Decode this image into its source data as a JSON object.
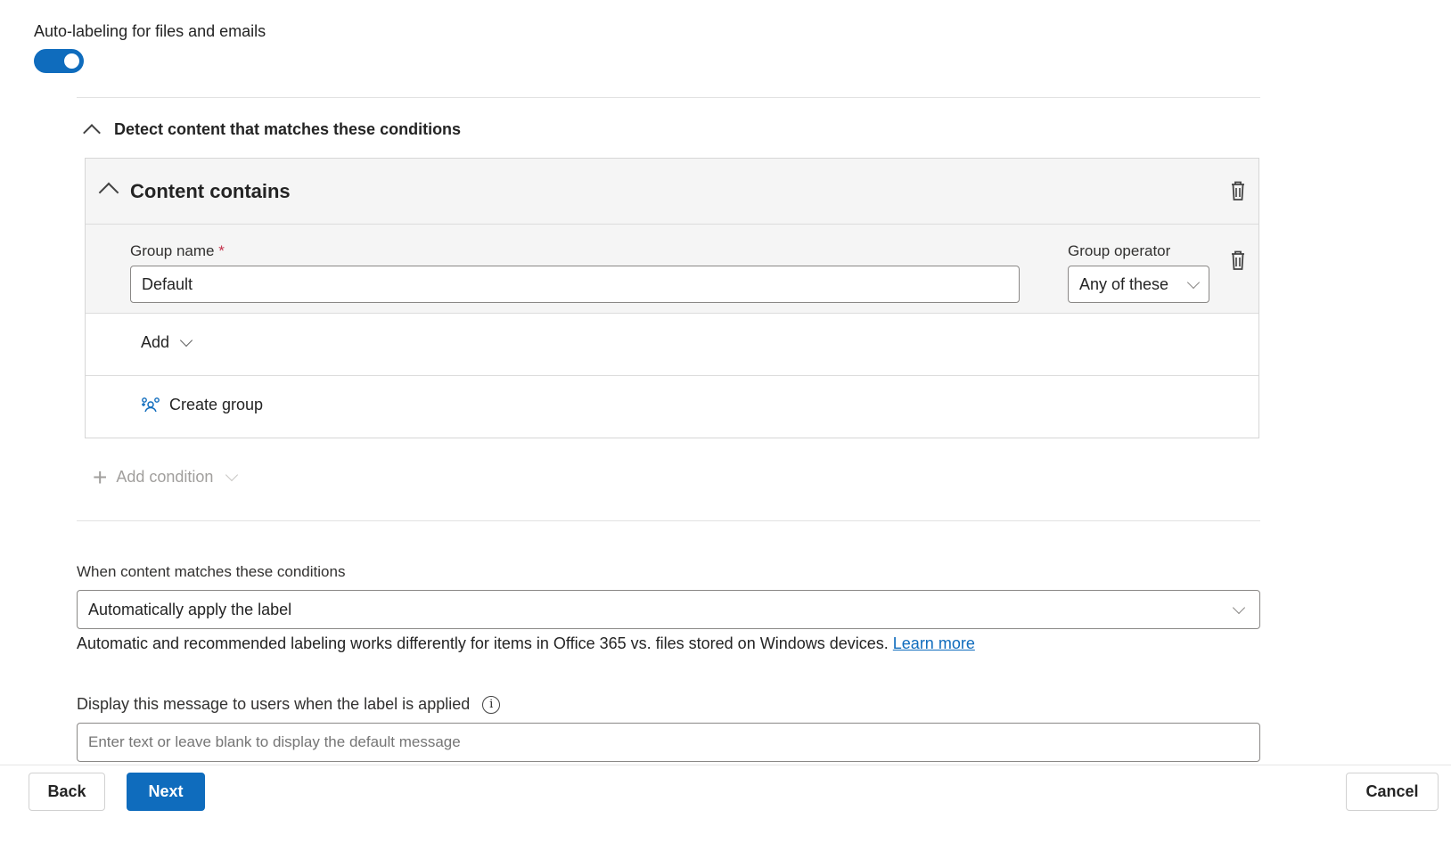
{
  "toggle": {
    "label": "Auto-labeling for files and emails",
    "on": true
  },
  "section": {
    "title": "Detect content that matches these conditions"
  },
  "condition": {
    "title": "Content contains",
    "group_name_label": "Group name",
    "required_marker": "*",
    "group_name_value": "Default",
    "group_operator_label": "Group operator",
    "group_operator_value": "Any of these",
    "add_label": "Add",
    "create_group_label": "Create group"
  },
  "add_condition_label": "Add condition",
  "action": {
    "label": "When content matches these conditions",
    "value": "Automatically apply the label",
    "helper_text": "Automatic and recommended labeling works differently for items in Office 365 vs. files stored on Windows devices.",
    "learn_more": "Learn more"
  },
  "message": {
    "label": "Display this message to users when the label is applied",
    "placeholder": "Enter text or leave blank to display the default message"
  },
  "footer": {
    "back": "Back",
    "next": "Next",
    "cancel": "Cancel"
  },
  "colors": {
    "accent": "#0f6cbd"
  }
}
